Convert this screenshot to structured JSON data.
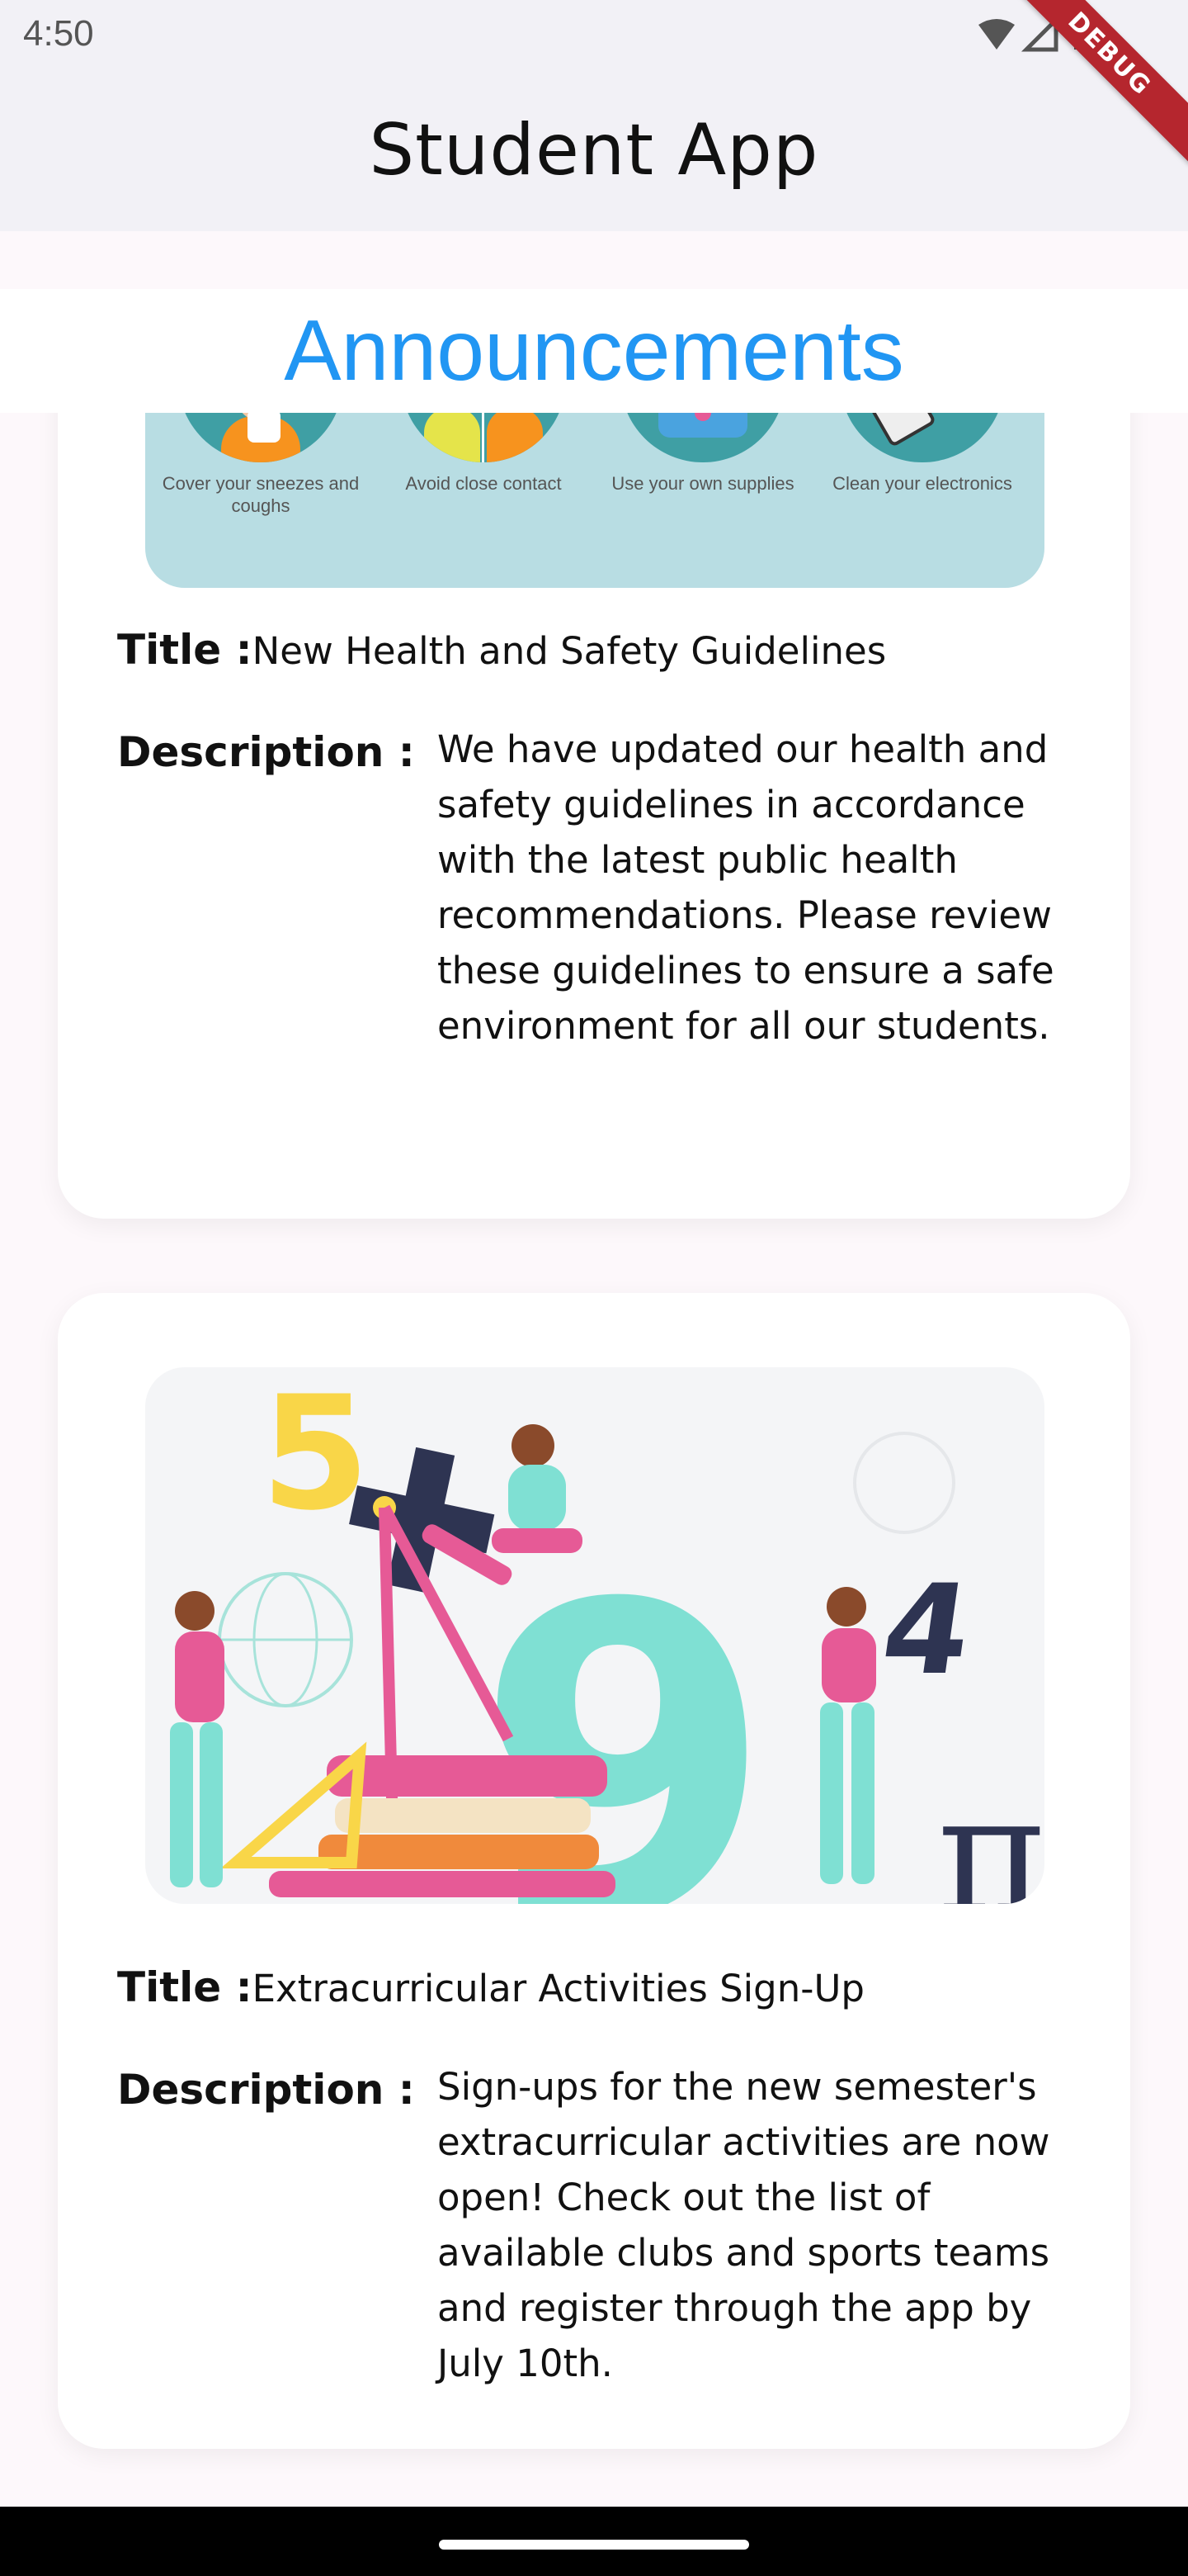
{
  "status_bar": {
    "time": "4:50"
  },
  "debug_banner": "DEBUG",
  "app_bar": {
    "title": "Student App"
  },
  "section": {
    "title": "Announcements"
  },
  "announcements": [
    {
      "image": {
        "labels": [
          "Cover your sneezes and coughs",
          "Avoid close contact",
          "Use your own supplies",
          "Clean your electronics"
        ]
      },
      "title_label": "Title :",
      "title": "New Health and Safety Guidelines",
      "description_label": "Description :",
      "description": "We have updated our health and safety guidelines in accordance with the latest public health recommendations. Please review these guidelines to ensure a safe environment for all our students."
    },
    {
      "image": {
        "glyphs": [
          "5",
          "4",
          "π",
          "9"
        ]
      },
      "title_label": "Title :",
      "title": "Extracurricular Activities Sign-Up",
      "description_label": "Description :",
      "description": "Sign-ups for the new semester's extracurricular activities are now open! Check out the list of available clubs and sports teams and register through the app by July 10th."
    }
  ],
  "colors": {
    "accent": "#2196f3",
    "debug": "#b5262e",
    "teal": "#7fe0d3",
    "pink": "#e65a96"
  }
}
